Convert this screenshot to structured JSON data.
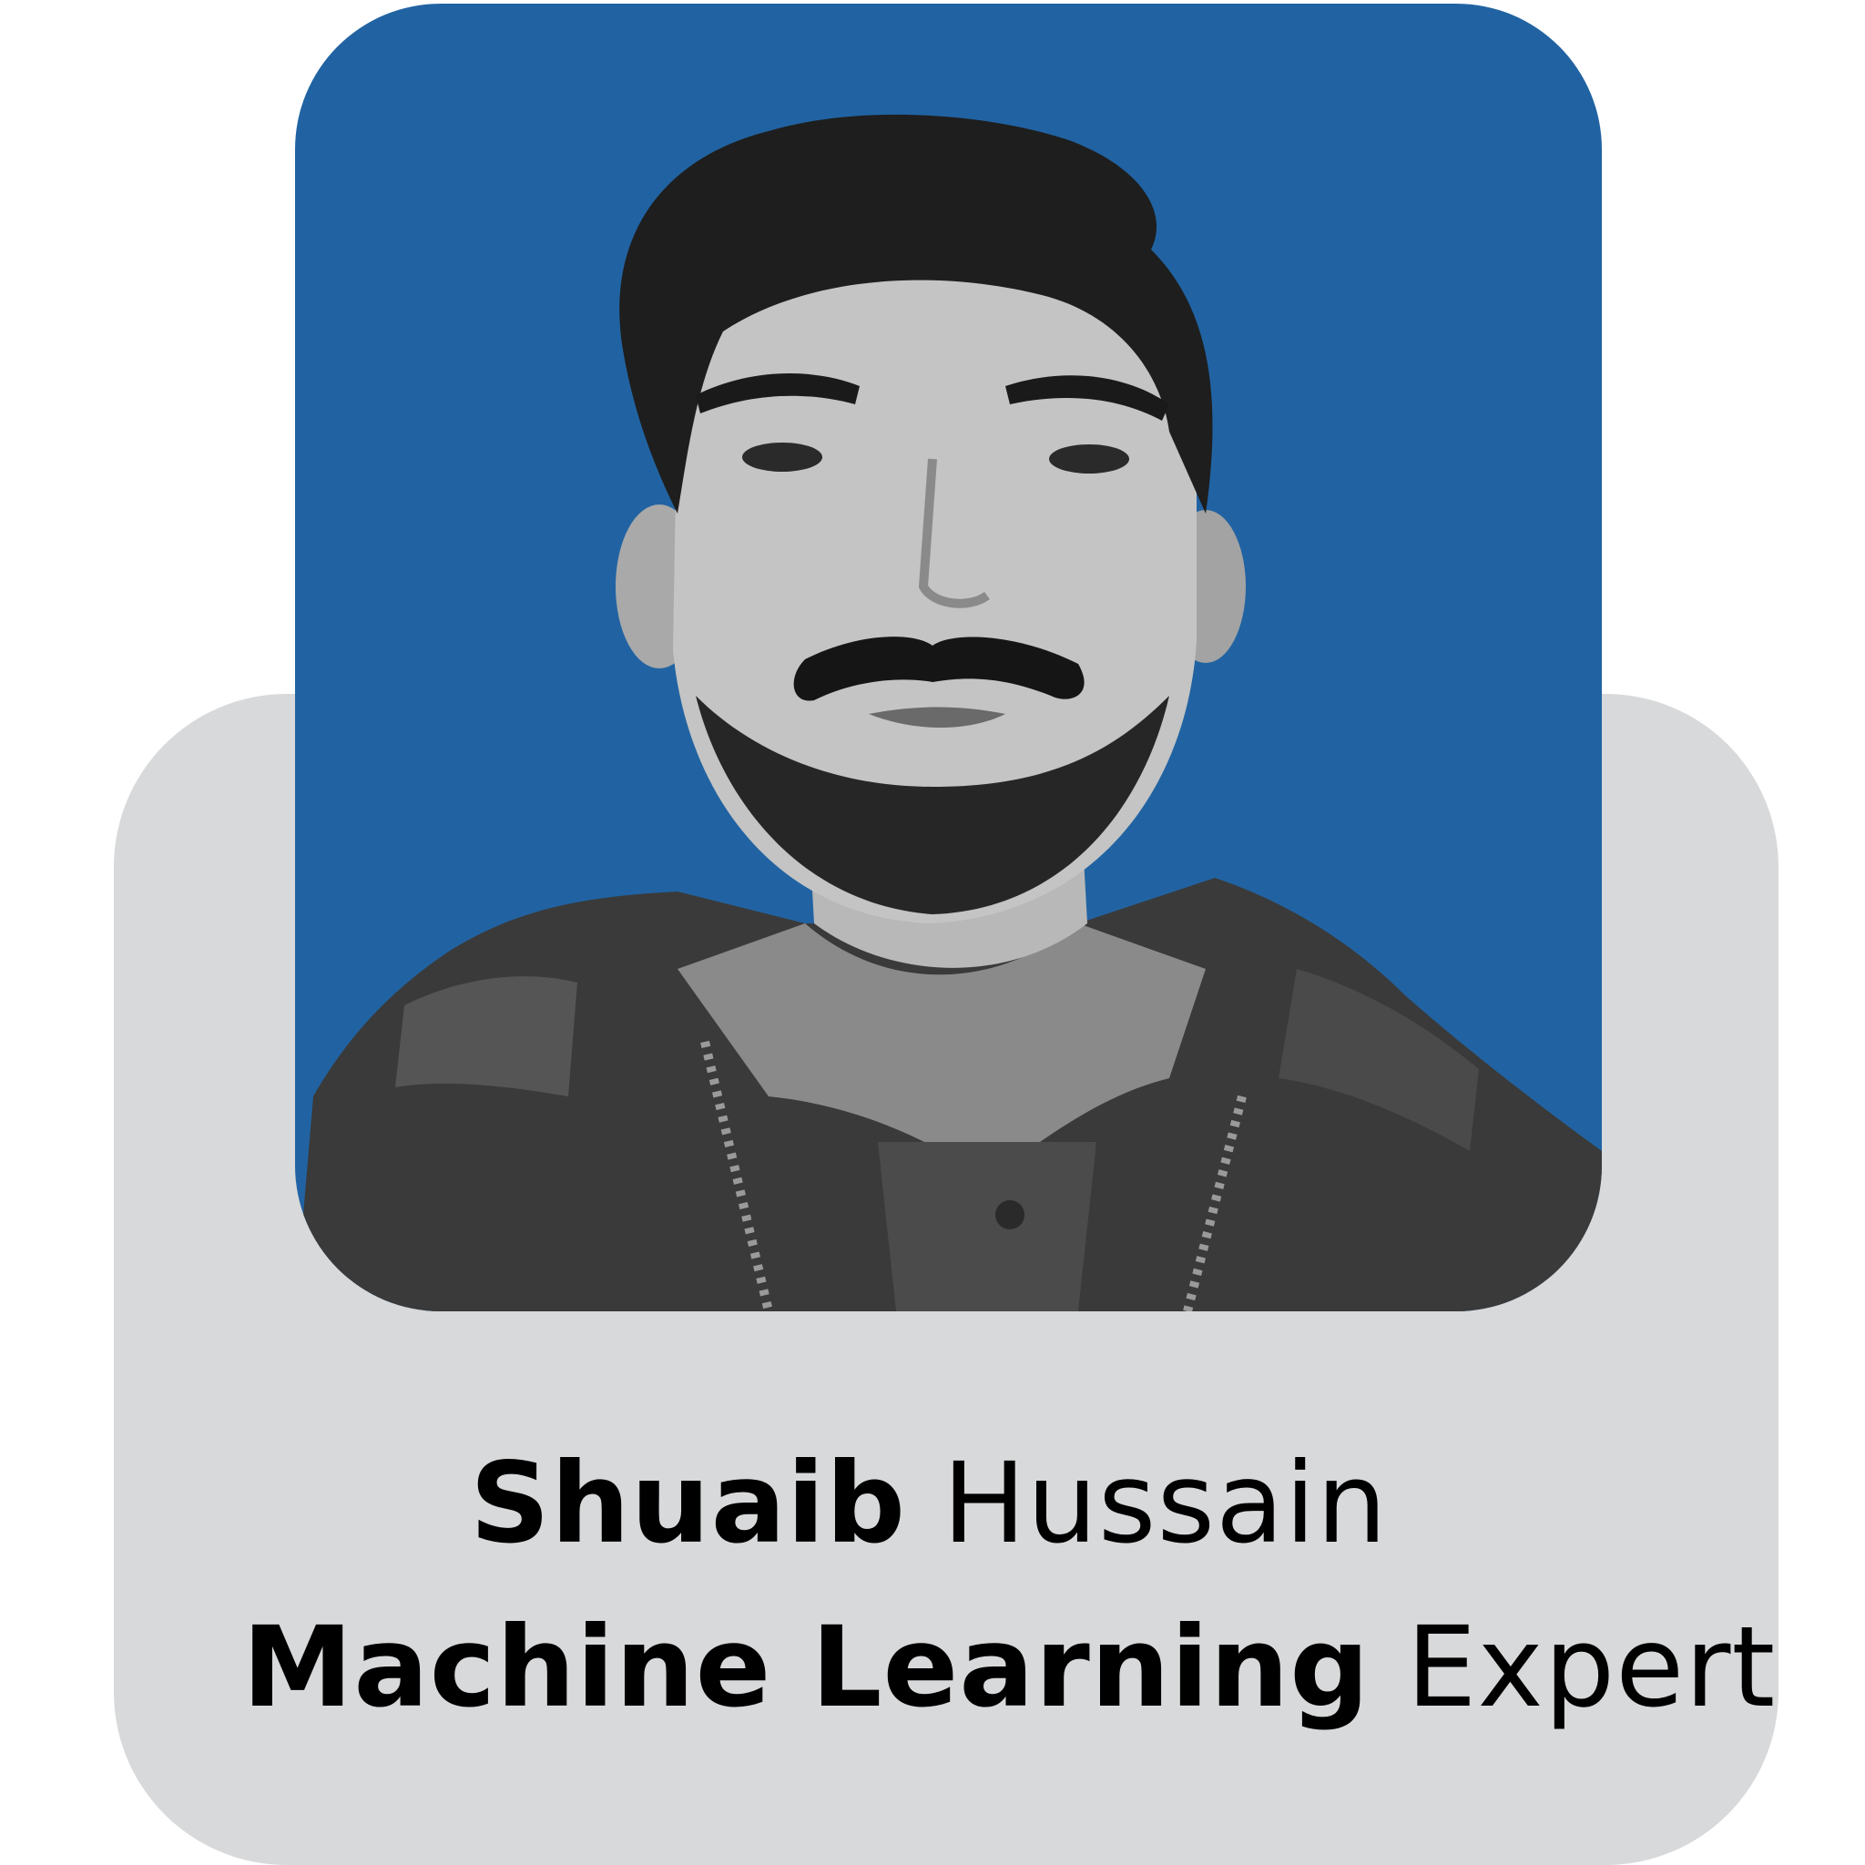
{
  "profile": {
    "first_name": "Shuaib",
    "last_name": "Hussain",
    "title_bold": "Machine Learning",
    "title_light": "Expert"
  },
  "colors": {
    "blue_panel": "#2163a2",
    "grey_panel": "#d8d9da",
    "text": "#000000"
  },
  "photo": {
    "icon": "person-portrait-icon",
    "style": "grayscale"
  }
}
